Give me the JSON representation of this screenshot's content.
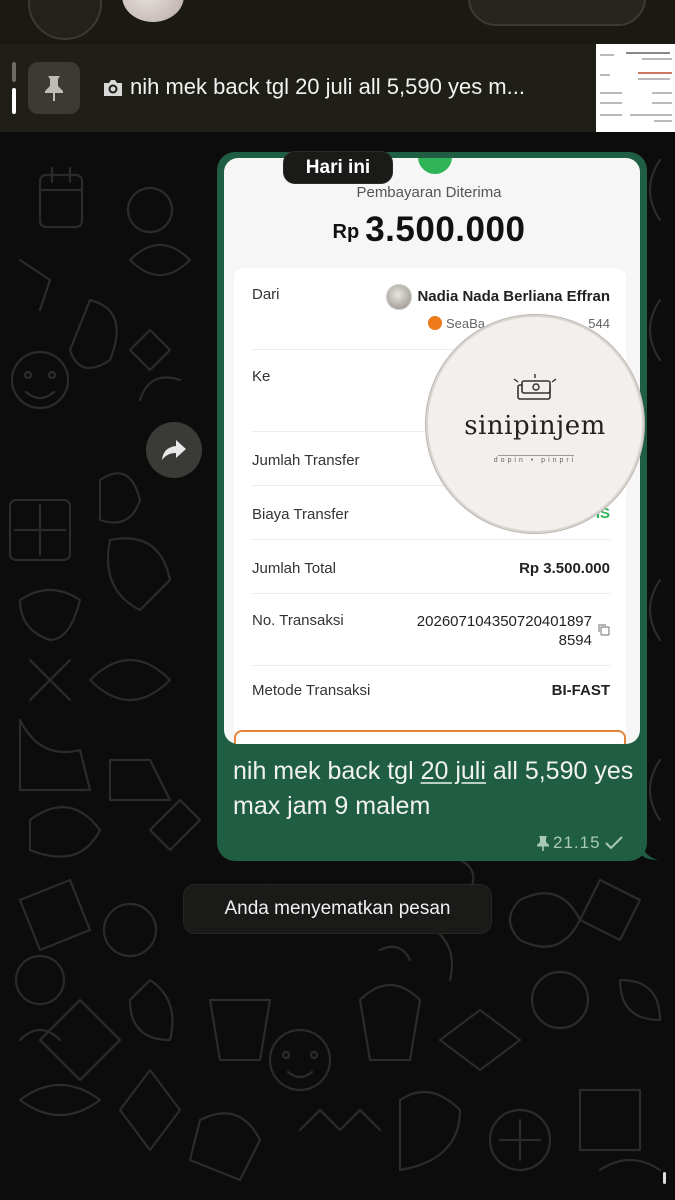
{
  "colors": {
    "bubble": "#1f5e43",
    "background": "#0b0c0b",
    "accent_green": "#2fb457",
    "pinbar": "#1f1e17"
  },
  "pinned": {
    "icon": "pin-icon",
    "media_icon": "camera-icon",
    "text": "nih mek back tgl 20 juli all 5,590 yes m..."
  },
  "date_chip": "Hari ini",
  "receipt": {
    "title": "Pembayaran Diterima",
    "currency": "Rp",
    "amount": "3.500.000",
    "rows": {
      "from_label": "Dari",
      "from_name": "Nadia Nada Berliana Effran",
      "from_bank": "SeaBa",
      "from_acct": "544",
      "to_label": "Ke",
      "transfer_label": "Jumlah Transfer",
      "fee_label": "Biaya Transfer",
      "fee_value": "IS",
      "total_label": "Jumlah Total",
      "total_value": "Rp 3.500.000",
      "trx_label": "No. Transaksi",
      "trx_line1": "20260710435072040189​7",
      "trx_line2": "8594",
      "method_label": "Metode Transaksi",
      "method_value": "BI-FAST"
    }
  },
  "watermark": {
    "word": "sinipinjem",
    "sub": "dopin • pinpri"
  },
  "message": {
    "text_before": "nih mek back tgl ",
    "text_underlined": "20 juli",
    "text_after": " all 5,590 yes max jam 9 malem",
    "time": "21.15"
  },
  "system_message": "Anda menyematkan pesan"
}
